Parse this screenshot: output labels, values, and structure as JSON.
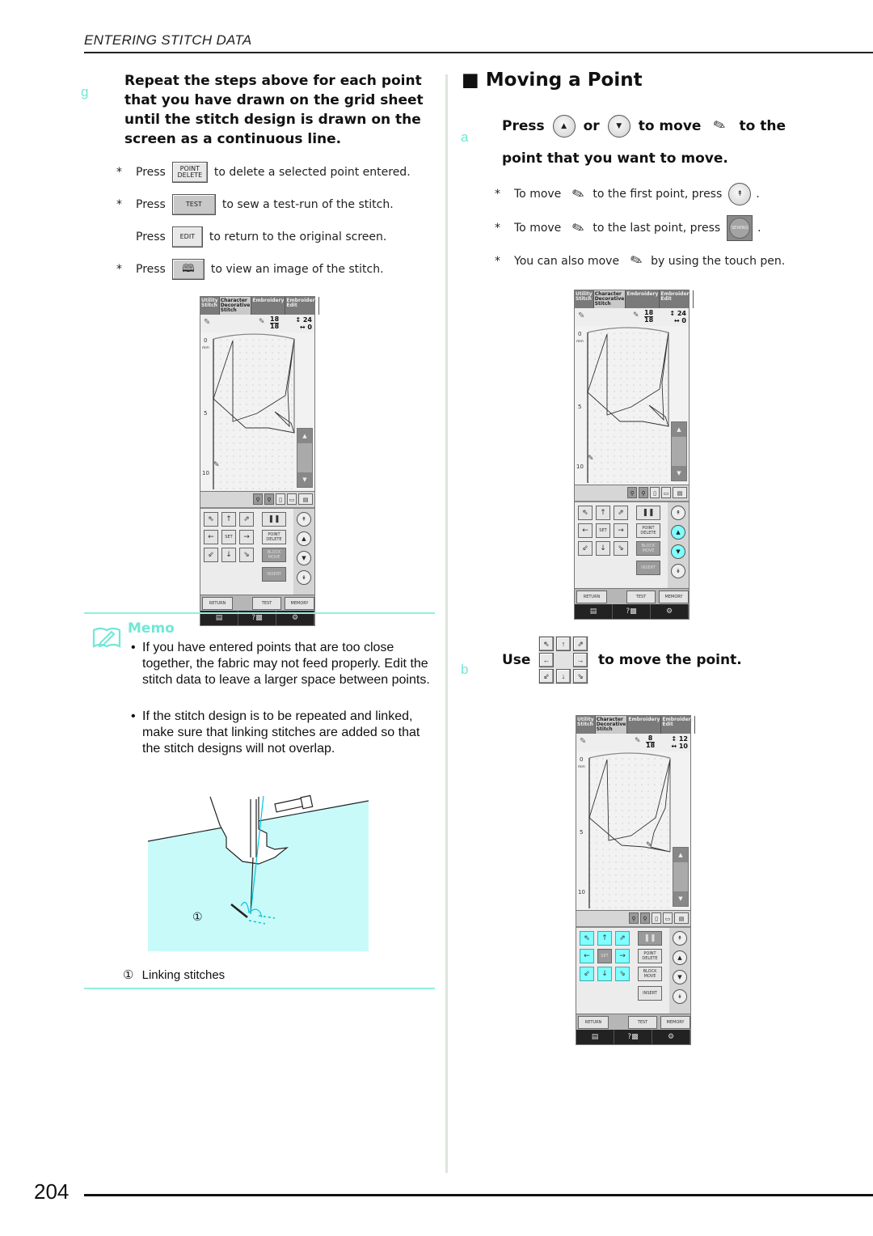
{
  "header": {
    "running_head": "ENTERING STITCH DATA"
  },
  "left": {
    "step_g": {
      "letter": "g",
      "text": "Repeat the steps above for each point that you have drawn on the grid sheet until the stitch design is drawn on the screen as a continuous line."
    },
    "notes": [
      {
        "star": "*",
        "press": "Press",
        "button": "POINT DELETE",
        "text": "to delete a selected point entered."
      },
      {
        "star": "*",
        "press": "Press",
        "button": "TEST",
        "text": "to sew a test-run of the stitch."
      },
      {
        "star": "",
        "press": "Press",
        "button": "EDIT",
        "text": "to return to the original screen."
      },
      {
        "star": "*",
        "press": "Press",
        "button": "stitch-image-icon",
        "text": "to view an image of the stitch."
      }
    ],
    "memo": {
      "title": "Memo",
      "bullets": [
        "If you have entered points that are too close together, the fabric may not feed properly. Edit the stitch data to leave a larger space between points.",
        "If the stitch design is to be repeated and linked, make sure that linking stitches are added so that the stitch designs will not overlap."
      ]
    },
    "illustration": {
      "callout": "①",
      "caption_num": "①",
      "caption": "Linking stitches"
    }
  },
  "right": {
    "section_title": "Moving a Point",
    "step_a": {
      "letter": "a",
      "press": "Press",
      "or": "or",
      "to_move": "to move",
      "to_the": "to the",
      "line2": "point that you want to move."
    },
    "notes": [
      {
        "star": "*",
        "text1": "To move",
        "text2": "to the first point, press",
        "end": "."
      },
      {
        "star": "*",
        "text1": "To move",
        "text2": "to the last point, press",
        "end": "."
      },
      {
        "star": "*",
        "text1": "You can also move",
        "text2": "by using the touch pen.",
        "end": ""
      }
    ],
    "sewing_label": "SEWING",
    "step_b": {
      "letter": "b",
      "use": "Use",
      "text": "to move the point."
    }
  },
  "screens": {
    "tabs": [
      "Utility Stitch",
      "Character Decorative Stitch",
      "Embroidery",
      "Embroidery Edit"
    ],
    "axis": {
      "top": "0",
      "unit": "mm",
      "mid": "5",
      "bottom": "10"
    },
    "buttons": {
      "set": "SET",
      "point_delete": "POINT DELETE",
      "block_move": "BLOCK MOVE",
      "insert": "INSERT",
      "return": "RETURN",
      "test": "TEST",
      "memory": "MEMORY"
    },
    "screen1": {
      "point_num": "18",
      "point_total": "18",
      "height": "24",
      "width": "0"
    },
    "screen2": {
      "point_num": "18",
      "point_total": "18",
      "height": "24",
      "width": "0"
    },
    "screen3": {
      "point_num": "8",
      "point_total": "18",
      "height": "12",
      "width": "10"
    }
  },
  "footer": {
    "page_number": "204"
  },
  "colors": {
    "accent": "#6fe8d6",
    "highlight": "#7fffff",
    "illustration_fill": "#c8fafa"
  }
}
